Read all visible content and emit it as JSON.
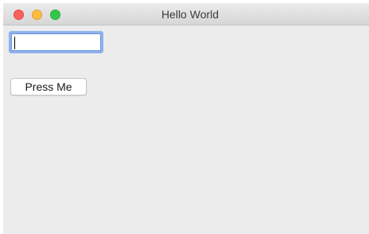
{
  "window": {
    "title": "Hello World",
    "controls": [
      "close",
      "minimize",
      "zoom"
    ]
  },
  "text_field": {
    "value": "",
    "focused": true
  },
  "button": {
    "label": "Press Me"
  },
  "colors": {
    "close": "#fc605c",
    "minimize": "#fdbc40",
    "zoom": "#34c84a",
    "focus_ring": "#8fb1ec",
    "window_bg": "#ececec"
  }
}
